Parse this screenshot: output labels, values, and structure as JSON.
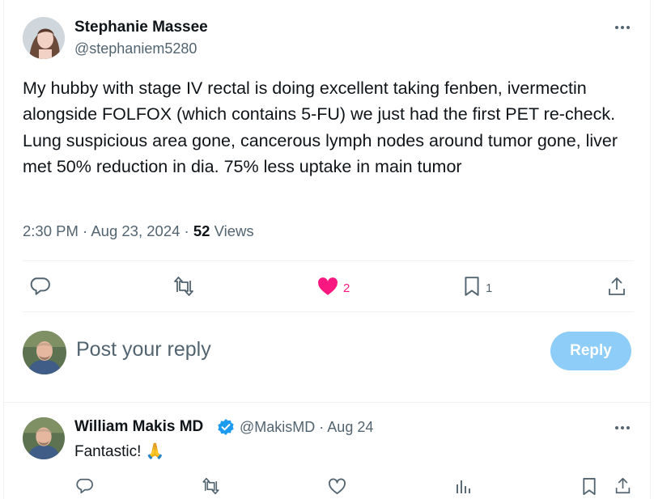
{
  "post": {
    "author_name": "Stephanie Massee",
    "author_handle": "@stephaniem5280",
    "text": "My hubby with stage IV rectal is doing excellent taking fenben, ivermectin alongside FOLFOX (which contains 5-FU) we just had the first PET re-check. Lung suspicious area gone, cancerous lymph nodes around tumor gone, liver met 50% reduction in dia. 75% less uptake in main tumor",
    "time": "2:30 PM",
    "date": "Aug 23, 2024",
    "views_count": "52",
    "views_label": "Views",
    "likes": "2",
    "bookmarks": "1",
    "like_color": "#f91880"
  },
  "compose": {
    "placeholder": "Post your reply",
    "button_label": "Reply"
  },
  "reply": {
    "author_name": "William Makis MD",
    "author_handle": "@MakisMD",
    "date": "Aug 24",
    "text": "Fantastic! 🙏"
  },
  "icons": {
    "more": "more-horizontal-icon",
    "reply": "comment-icon",
    "repost": "repost-icon",
    "like": "heart-icon",
    "bookmark": "bookmark-icon",
    "share": "share-icon",
    "views": "analytics-icon",
    "verified": "verified-badge-icon"
  },
  "colors": {
    "accent": "#1d9bf0",
    "reply_button": "#8ecdf8"
  }
}
